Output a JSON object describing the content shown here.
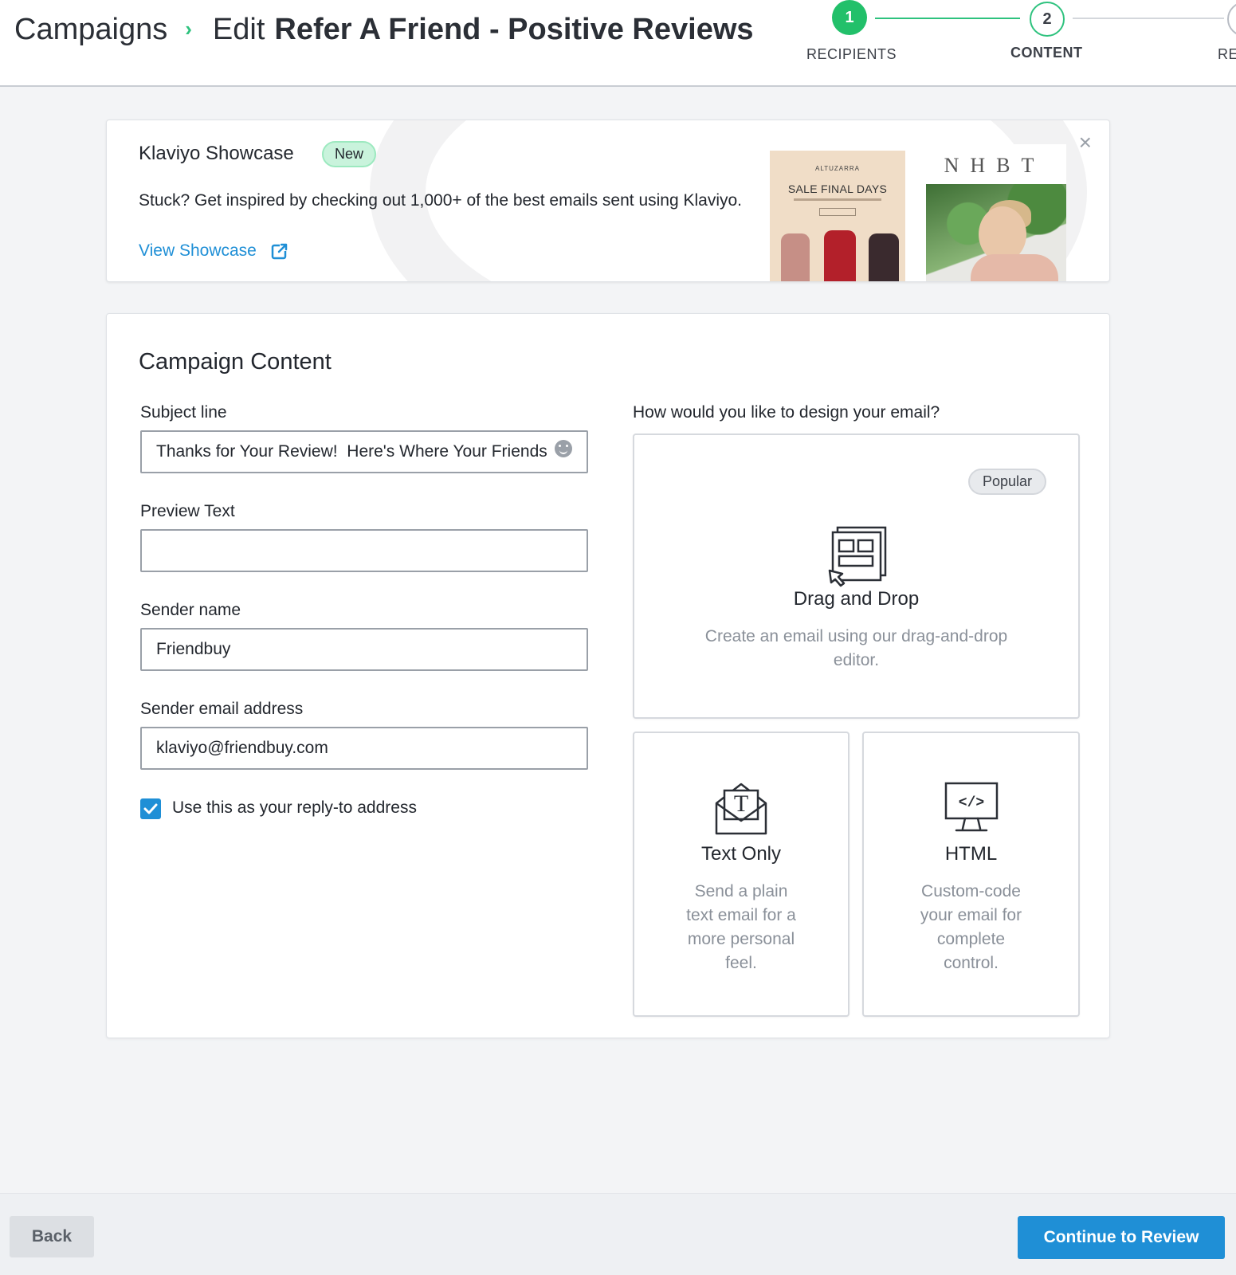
{
  "header": {
    "breadcrumb_parent": "Campaigns",
    "breadcrumb_separator": "›",
    "edit_label": "Edit",
    "campaign_name": "Refer A Friend - Positive Reviews"
  },
  "steps": [
    {
      "number": "1",
      "label": "RECIPIENTS",
      "state": "complete"
    },
    {
      "number": "2",
      "label": "CONTENT",
      "state": "current"
    },
    {
      "number": "",
      "label": "RE",
      "state": "upcoming"
    }
  ],
  "showcase": {
    "title": "Klaviyo Showcase",
    "badge": "New",
    "description": "Stuck? Get inspired by checking out 1,000+ of the best emails sent using Klaviyo.",
    "link_label": "View Showcase",
    "close_symbol": "×",
    "thumb1": {
      "brand": "ALTUZARRA",
      "headline": "SALE FINAL DAYS"
    },
    "thumb2": {
      "brand": "NHBT"
    }
  },
  "content": {
    "title": "Campaign Content",
    "subject_label": "Subject line",
    "subject_value": "Thanks for Your Review!  Here's Where Your Friends",
    "preview_label": "Preview Text",
    "preview_value": "",
    "sender_name_label": "Sender name",
    "sender_name_value": "Friendbuy",
    "sender_email_label": "Sender email address",
    "sender_email_value": "klaviyo@friendbuy.com",
    "reply_to_label": "Use this as your reply-to address",
    "reply_to_checked": true
  },
  "design": {
    "question": "How would you like to design your email?",
    "options": [
      {
        "badge": "Popular",
        "title": "Drag and Drop",
        "description": "Create an email using our drag-and-drop editor."
      },
      {
        "title": "Text Only",
        "description": "Send a plain text email for a more personal feel."
      },
      {
        "title": "HTML",
        "description": "Custom-code your email for complete control."
      }
    ]
  },
  "footer": {
    "back_label": "Back",
    "continue_label": "Continue to Review"
  },
  "colors": {
    "accent_blue": "#1f8fd6",
    "success_green": "#22c06a"
  }
}
